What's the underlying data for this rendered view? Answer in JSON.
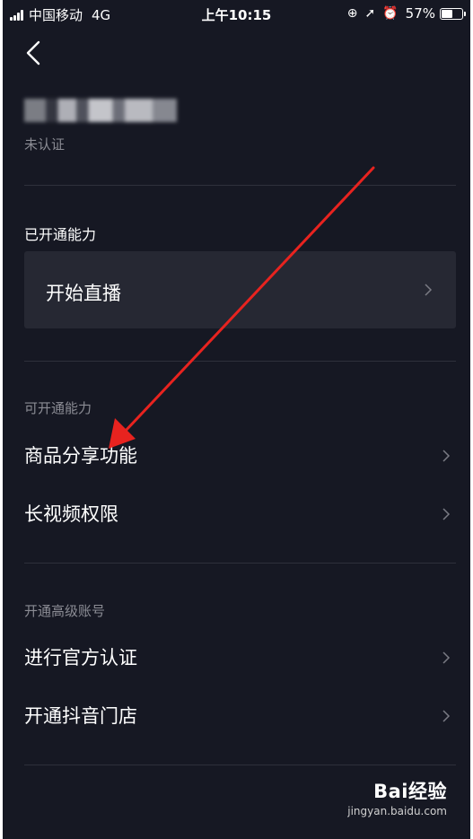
{
  "status_bar": {
    "carrier": "中国移动",
    "network": "4G",
    "time": "上午10:15",
    "battery": "57%",
    "battery_level": 0.57
  },
  "header": {
    "back_icon": "chevron-left-icon",
    "certification_status": "未认证"
  },
  "opened": {
    "title": "已开通能力",
    "items": [
      {
        "label": "开始直播"
      }
    ]
  },
  "available": {
    "title": "可开通能力",
    "items": [
      {
        "label": "商品分享功能"
      },
      {
        "label": "长视频权限"
      }
    ]
  },
  "advanced": {
    "title": "开通高级账号",
    "items": [
      {
        "label": "进行官方认证"
      },
      {
        "label": "开通抖音门店"
      }
    ]
  },
  "watermark": {
    "logo": "Bai经验",
    "url": "jingyan.baidu.com"
  },
  "colors": {
    "background": "#161823",
    "card": "#262833",
    "muted_text": "#8b8c94",
    "annotation_arrow": "#e8231f"
  }
}
